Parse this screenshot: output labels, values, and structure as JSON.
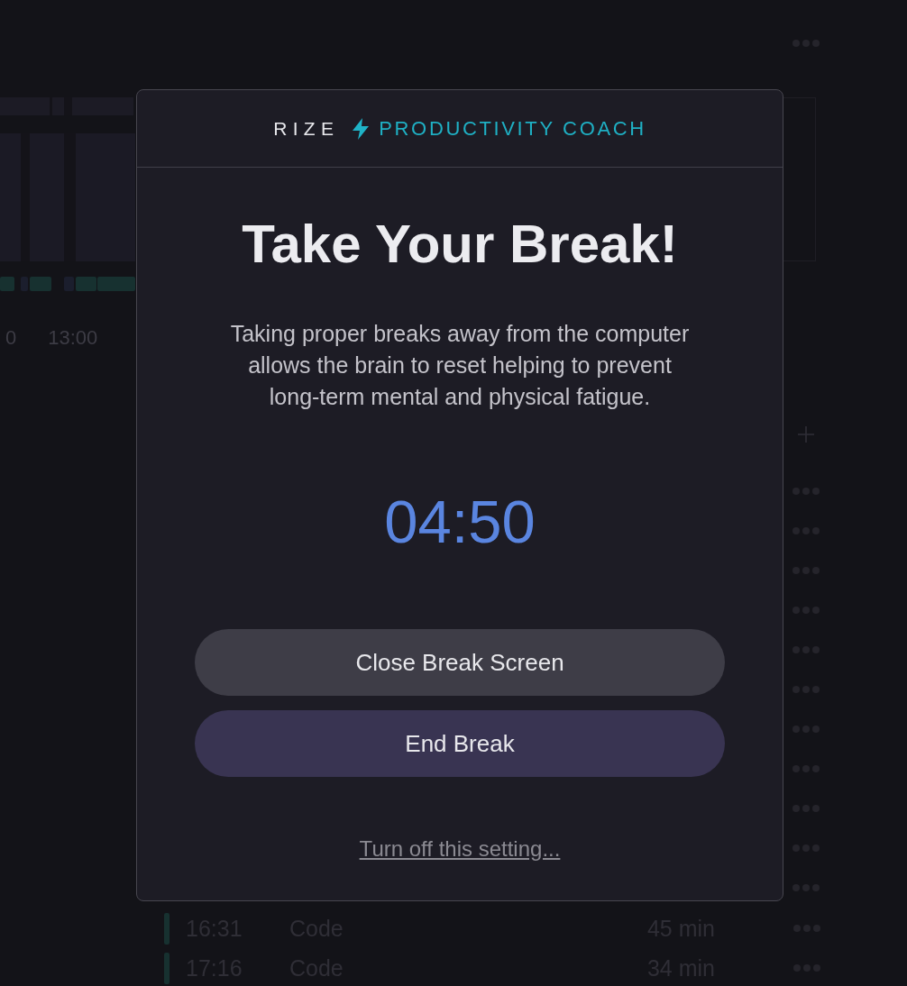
{
  "background": {
    "timeline": {
      "hour_labels": [
        "0",
        "13:00"
      ]
    },
    "rows": [
      {
        "time": "16:31",
        "category": "Code",
        "duration": "45 min"
      },
      {
        "time": "17:16",
        "category": "Code",
        "duration": "34 min"
      }
    ]
  },
  "dialog": {
    "brand": "RIZE",
    "product": "PRODUCTIVITY COACH",
    "title": "Take Your Break!",
    "message": "Taking proper breaks away from the computer allows the brain to reset helping to prevent long-term mental and physical fatigue.",
    "timer": "04:50",
    "buttons": [
      {
        "label": "Close Break Screen",
        "kind": "secondary"
      },
      {
        "label": "End Break",
        "kind": "primary"
      }
    ],
    "link": "Turn off this setting..."
  }
}
